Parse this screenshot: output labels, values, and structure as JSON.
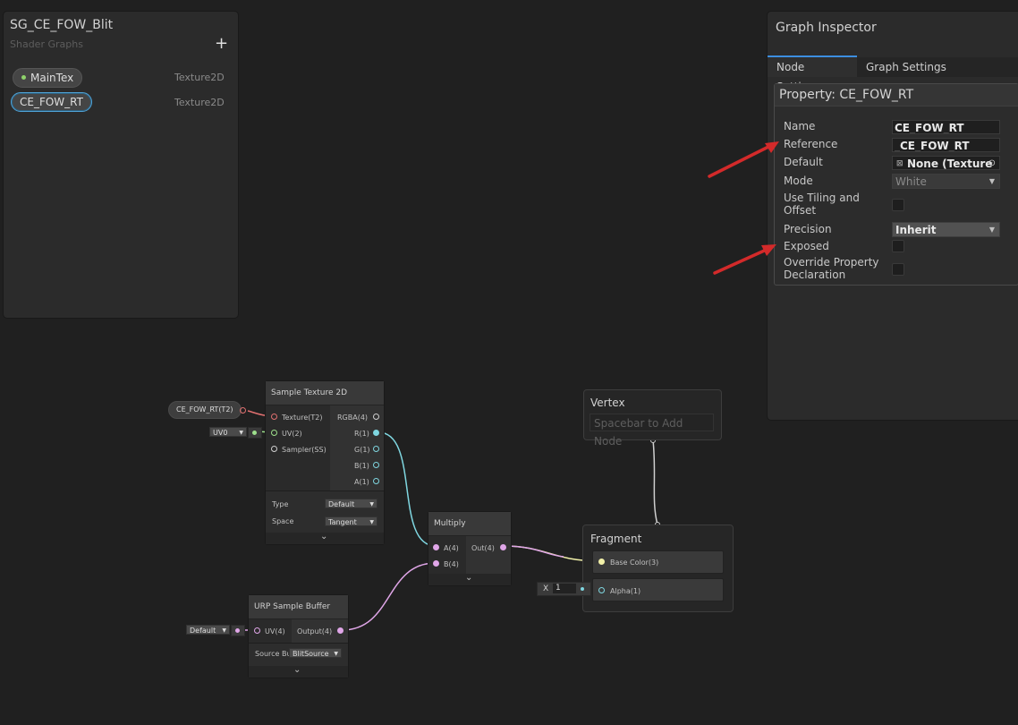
{
  "blackboard": {
    "title": "SG_CE_FOW_Blit",
    "subtitle": "Shader Graphs",
    "add_label": "+",
    "properties": [
      {
        "name": "MainTex",
        "type": "Texture2D"
      },
      {
        "name": "CE_FOW_RT",
        "type": "Texture2D"
      }
    ]
  },
  "inspector": {
    "title": "Graph Inspector",
    "tabs": [
      "Node Settings",
      "Graph Settings"
    ],
    "active_tab": "Node Settings",
    "property_header": "Property: CE_FOW_RT",
    "rows": {
      "name_label": "Name",
      "name_value": "CE_FOW_RT",
      "reference_label": "Reference",
      "reference_value": "_CE_FOW_RT",
      "default_label": "Default",
      "default_value": "None (Texture",
      "mode_label": "Mode",
      "mode_value": "White",
      "tiling_label_1": "Use Tiling and",
      "tiling_label_2": "Offset",
      "precision_label": "Precision",
      "precision_value": "Inherit",
      "exposed_label": "Exposed",
      "override_label_1": "Override Property",
      "override_label_2": "Declaration"
    }
  },
  "nodes": {
    "property_node": {
      "label": "CE_FOW_RT(T2)"
    },
    "uv_dropdown": {
      "value": "UV0"
    },
    "sample_texture": {
      "title": "Sample Texture 2D",
      "inputs": [
        "Texture(T2)",
        "UV(2)",
        "Sampler(SS)"
      ],
      "outputs": [
        "RGBA(4)",
        "R(1)",
        "G(1)",
        "B(1)",
        "A(1)"
      ],
      "type_label": "Type",
      "type_value": "Default",
      "space_label": "Space",
      "space_value": "Tangent"
    },
    "multiply": {
      "title": "Multiply",
      "inputs": [
        "A(4)",
        "B(4)"
      ],
      "output": "Out(4)"
    },
    "urp_buffer": {
      "title": "URP Sample Buffer",
      "input": "UV(4)",
      "output": "Output(4)",
      "source_label": "Source Bu",
      "source_value": "BlitSource",
      "default_dropdown": "Default"
    },
    "vertex": {
      "title": "Vertex",
      "placeholder": "Spacebar to Add Node"
    },
    "fragment": {
      "title": "Fragment",
      "blocks": [
        "Base Color(3)",
        "Alpha(1)"
      ],
      "alpha_field_label": "X",
      "alpha_field_value": "1"
    }
  },
  "colors": {
    "arrow": "#d32a2a",
    "wire_texture": "#e07070",
    "wire_uv": "#9ee08c",
    "wire_r": "#7fd6e0",
    "wire_vec4": "#e0a6e8",
    "wire_vec3": "#f1f0a8",
    "wire_float": "#7fd6e0"
  }
}
